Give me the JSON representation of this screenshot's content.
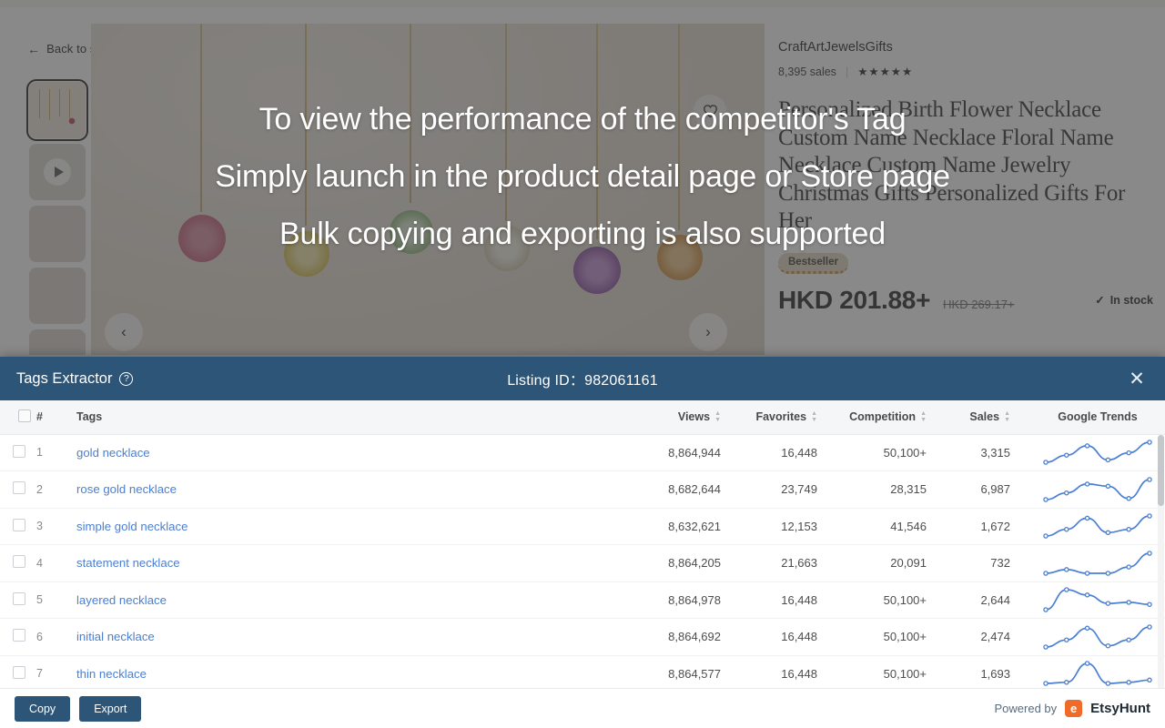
{
  "background": {
    "back_link": "Back to search results",
    "back_arrow_icon": "left-arrow-icon",
    "shop_name": "CraftArtJewelsGifts",
    "sales_text": "8,395 sales",
    "stars": "★★★★★",
    "product_title": "Personalized Birth Flower Necklace Custom Name Necklace Floral Name Necklace Custom Name Jewelry Christmas Gifts Personalized Gifts For Her",
    "bestseller_badge": "Bestseller",
    "price_current": "HKD 201.88+",
    "price_original": "HKD 269.17+",
    "stock_status": "In stock",
    "stock_check_icon": "check-icon",
    "favorite_icon": "heart-icon",
    "carousel_prev": "‹",
    "carousel_next": "›",
    "thumbnails": [
      {
        "name": "thumbnail-1-selected",
        "kind": "image"
      },
      {
        "name": "thumbnail-2-video",
        "kind": "video"
      },
      {
        "name": "thumbnail-3",
        "kind": "empty"
      },
      {
        "name": "thumbnail-4",
        "kind": "empty"
      },
      {
        "name": "thumbnail-5",
        "kind": "empty"
      }
    ]
  },
  "overlay": {
    "line1": "To view the performance of the competitor's Tag",
    "line2": "Simply launch in the product detail page or Store page",
    "line3": "Bulk copying and exporting is also supported"
  },
  "panel": {
    "title": "Tags Extractor",
    "help_icon": "question-mark-icon",
    "listing_id_label": "Listing ID：",
    "listing_id_value": "982061161",
    "close_icon": "close-icon",
    "accent_color": "#2c5578",
    "link_color": "#4a7fd4",
    "columns": {
      "number": "#",
      "tags": "Tags",
      "views": "Views",
      "favorites": "Favorites",
      "competition": "Competition",
      "sales": "Sales",
      "google_trends": "Google Trends"
    },
    "rows": [
      {
        "n": "1",
        "tag": "gold necklace",
        "views": "8,864,944",
        "favorites": "16,448",
        "competition": "50,100+",
        "sales": "3,315",
        "trend": [
          22,
          16,
          8,
          20,
          14,
          5
        ]
      },
      {
        "n": "2",
        "tag": "rose gold necklace",
        "views": "8,682,644",
        "favorites": "23,749",
        "competition": "28,315",
        "sales": "6,987",
        "trend": [
          24,
          18,
          10,
          12,
          23,
          6
        ]
      },
      {
        "n": "3",
        "tag": "simple gold necklace",
        "views": "8,632,621",
        "favorites": "12,153",
        "competition": "41,546",
        "sales": "1,672",
        "trend": [
          24,
          18,
          8,
          21,
          18,
          6
        ]
      },
      {
        "n": "4",
        "tag": "statement necklace",
        "views": "8,864,205",
        "favorites": "21,663",
        "competition": "20,091",
        "sales": "732",
        "trend": [
          21,
          18,
          21,
          21,
          16,
          5
        ]
      },
      {
        "n": "5",
        "tag": "layered necklace",
        "views": "8,864,978",
        "favorites": "16,448",
        "competition": "50,100+",
        "sales": "2,644",
        "trend": [
          26,
          7,
          12,
          20,
          19,
          21
        ]
      },
      {
        "n": "6",
        "tag": "initial necklace",
        "views": "8,864,692",
        "favorites": "16,448",
        "competition": "50,100+",
        "sales": "2,474",
        "trend": [
          23,
          17,
          7,
          22,
          17,
          6
        ]
      },
      {
        "n": "7",
        "tag": "thin necklace",
        "views": "8,864,577",
        "favorites": "16,448",
        "competition": "50,100+",
        "sales": "1,693",
        "trend": [
          23,
          22,
          5,
          23,
          22,
          20
        ]
      }
    ],
    "footer": {
      "copy_label": "Copy",
      "export_label": "Export",
      "powered_by": "Powered by",
      "brand": "EtsyHunt",
      "brand_icon": "etsyhunt-logo-icon"
    }
  }
}
